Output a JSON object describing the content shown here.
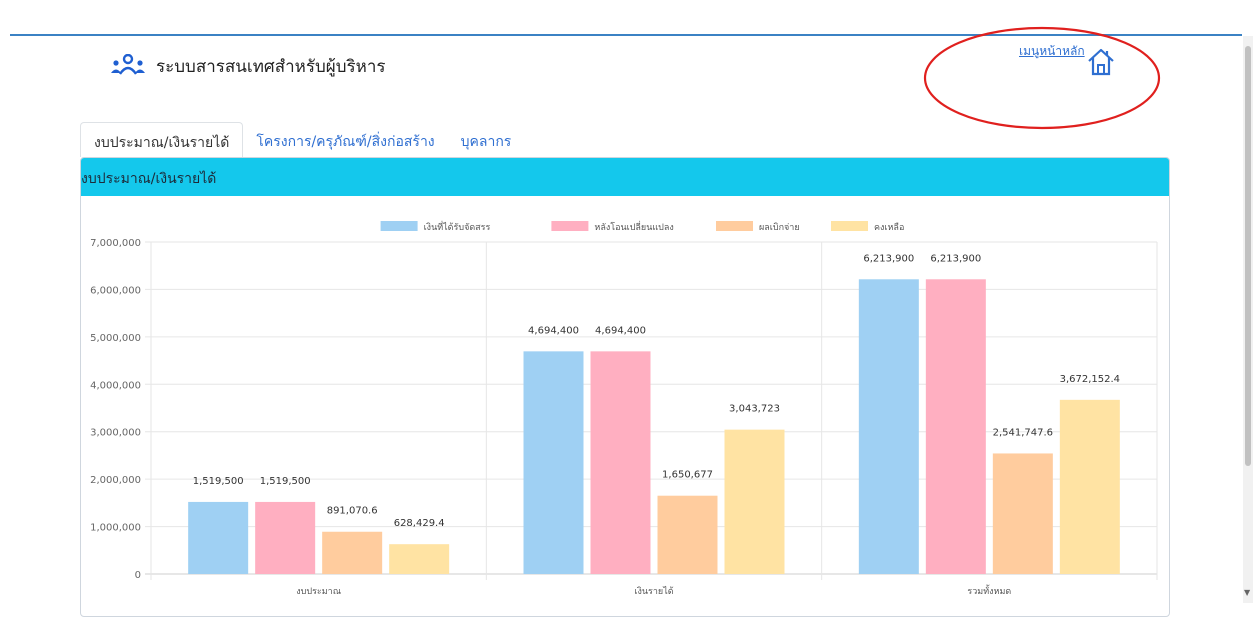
{
  "header": {
    "title": "ระบบสารสนเทศสำหรับผู้บริหาร",
    "home_link": "เมนูหน้าหลัก",
    "brand_icon": "users-icon",
    "home_icon": "home-icon"
  },
  "tabs": [
    {
      "label": "งบประมาณ/เงินรายได้",
      "active": true
    },
    {
      "label": "โครงการ/ครุภัณฑ์/สิ่งก่อสร้าง",
      "active": false
    },
    {
      "label": "บุคลากร",
      "active": false
    }
  ],
  "card": {
    "title": "งบประมาณ/เงินรายได้"
  },
  "colors": {
    "accent": "#14c8ec",
    "link": "#2f6fd1",
    "annotation": "#e0201e"
  },
  "chart_data": {
    "type": "bar",
    "categories": [
      "งบประมาณ",
      "เงินรายได้",
      "รวมทั้งหมด"
    ],
    "series": [
      {
        "name": "เงินที่ได้รับจัดสรร",
        "color": "#9fd0f3",
        "values": [
          1519500,
          4694400,
          6213900
        ],
        "labels": [
          "1,519,500",
          "4,694,400",
          "6,213,900"
        ]
      },
      {
        "name": "หลังโอนเปลี่ยนแปลง",
        "color": "#ffafc1",
        "values": [
          1519500,
          4694400,
          6213900
        ],
        "labels": [
          "1,519,500",
          "4,694,400",
          "6,213,900"
        ]
      },
      {
        "name": "ผลเบิกจ่าย",
        "color": "#ffcc9e",
        "values": [
          891070.6,
          1650677,
          2541747.6
        ],
        "labels": [
          "891,070.6",
          "1,650,677",
          "2,541,747.6"
        ]
      },
      {
        "name": "คงเหลือ",
        "color": "#ffe3a3",
        "values": [
          628429.4,
          3043723,
          3672152.4
        ],
        "labels": [
          "628,429.4",
          "3,043,723",
          "3,672,152.4"
        ]
      }
    ],
    "yticks": [
      "0",
      "1,000,000",
      "2,000,000",
      "3,000,000",
      "4,000,000",
      "5,000,000",
      "6,000,000",
      "7,000,000"
    ],
    "ylim": [
      0,
      7000000
    ],
    "legend_position": "top",
    "grid": true
  }
}
